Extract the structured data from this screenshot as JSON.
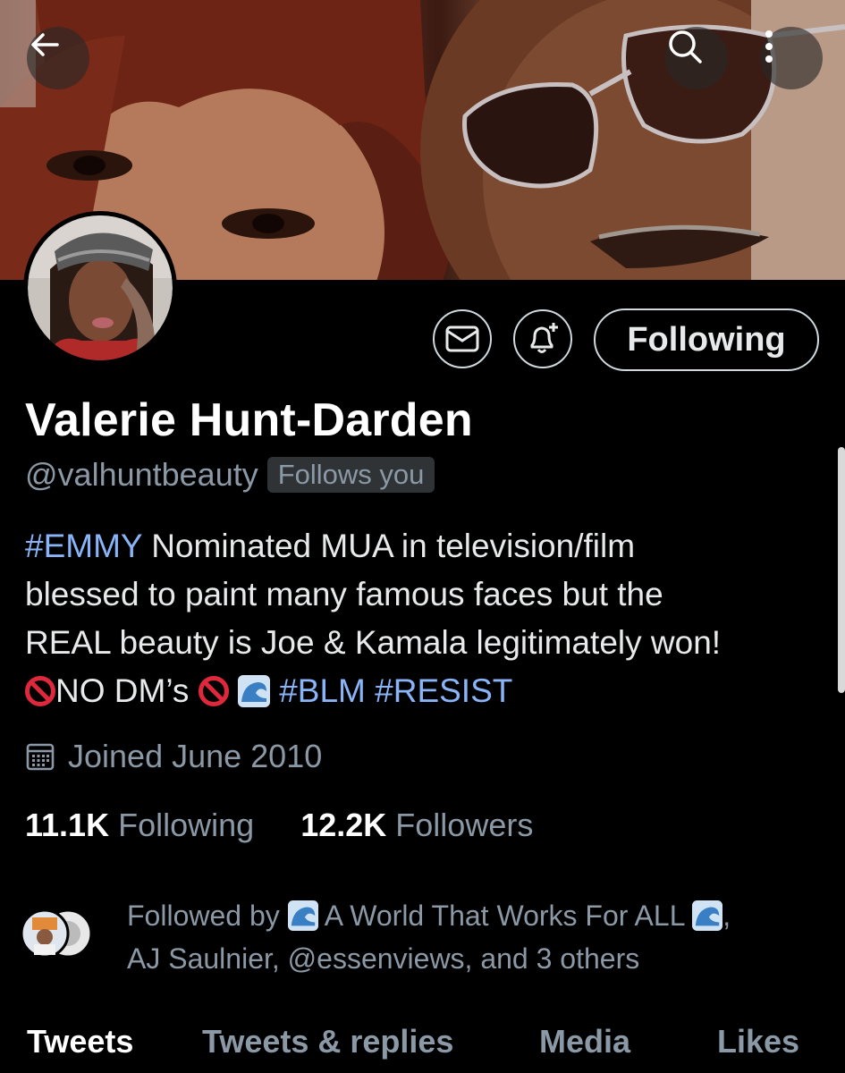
{
  "banner": {
    "description_icons": [
      "back-arrow-icon",
      "search-icon",
      "more-vertical-icon"
    ]
  },
  "actions": {
    "message_icon": "envelope-icon",
    "notify_icon": "bell-plus-icon",
    "follow_label": "Following"
  },
  "profile": {
    "name": "Valerie Hunt-Darden",
    "handle": "@valhuntbeauty",
    "follows_you": "Follows you",
    "bio": {
      "hashtag_emmy": "#EMMY",
      "line1_rest": " Nominated MUA in television/film",
      "line2": "blessed to paint many famous faces but the",
      "line3": "REAL beauty is Joe & Kamala legitimately won!",
      "line4_text": "NO DM’s",
      "hashtag_blm": "#BLM",
      "hashtag_resist": "#RESIST"
    },
    "joined": "Joined June 2010",
    "following_count": "11.1K",
    "following_label": "Following",
    "followers_count": "12.2K",
    "followers_label": "Followers"
  },
  "followed_by": {
    "prefix": "Followed by",
    "account1": "A World That Works For ALL",
    "line1_suffix": ",",
    "line2": "AJ Saulnier, @essenviews, and 3 others"
  },
  "tabs": [
    {
      "label": "Tweets",
      "active": true
    },
    {
      "label": "Tweets & replies",
      "active": false
    },
    {
      "label": "Media",
      "active": false
    },
    {
      "label": "Likes",
      "active": false
    }
  ],
  "colors": {
    "accent_link": "#8ab4f8",
    "muted": "#8b98a5",
    "background": "#000000"
  }
}
